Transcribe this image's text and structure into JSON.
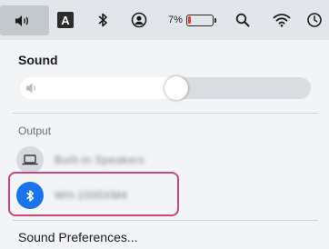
{
  "menubar": {
    "sound_icon": "speaker-icon",
    "input_source_letter": "A",
    "bluetooth_icon": "bluetooth-icon",
    "user_icon": "user-circle-icon",
    "battery_percent": "7%",
    "battery_level": 0.07,
    "battery_color": "#e23a34",
    "search_icon": "magnifier-icon",
    "wifi_icon": "wifi-icon",
    "clock_icon": "clock-icon"
  },
  "sound": {
    "title": "Sound",
    "volume_level": 0.54
  },
  "output": {
    "title": "Output",
    "devices": [
      {
        "name": "Built-in Speakers",
        "icon": "laptop-icon",
        "selected": false
      },
      {
        "name": "WH-1000XM4",
        "icon": "bluetooth-icon",
        "selected": true
      }
    ]
  },
  "footer": {
    "preferences_label": "Sound Preferences..."
  },
  "colors": {
    "accent": "#1a73e8",
    "highlight_border": "#c8477f"
  }
}
